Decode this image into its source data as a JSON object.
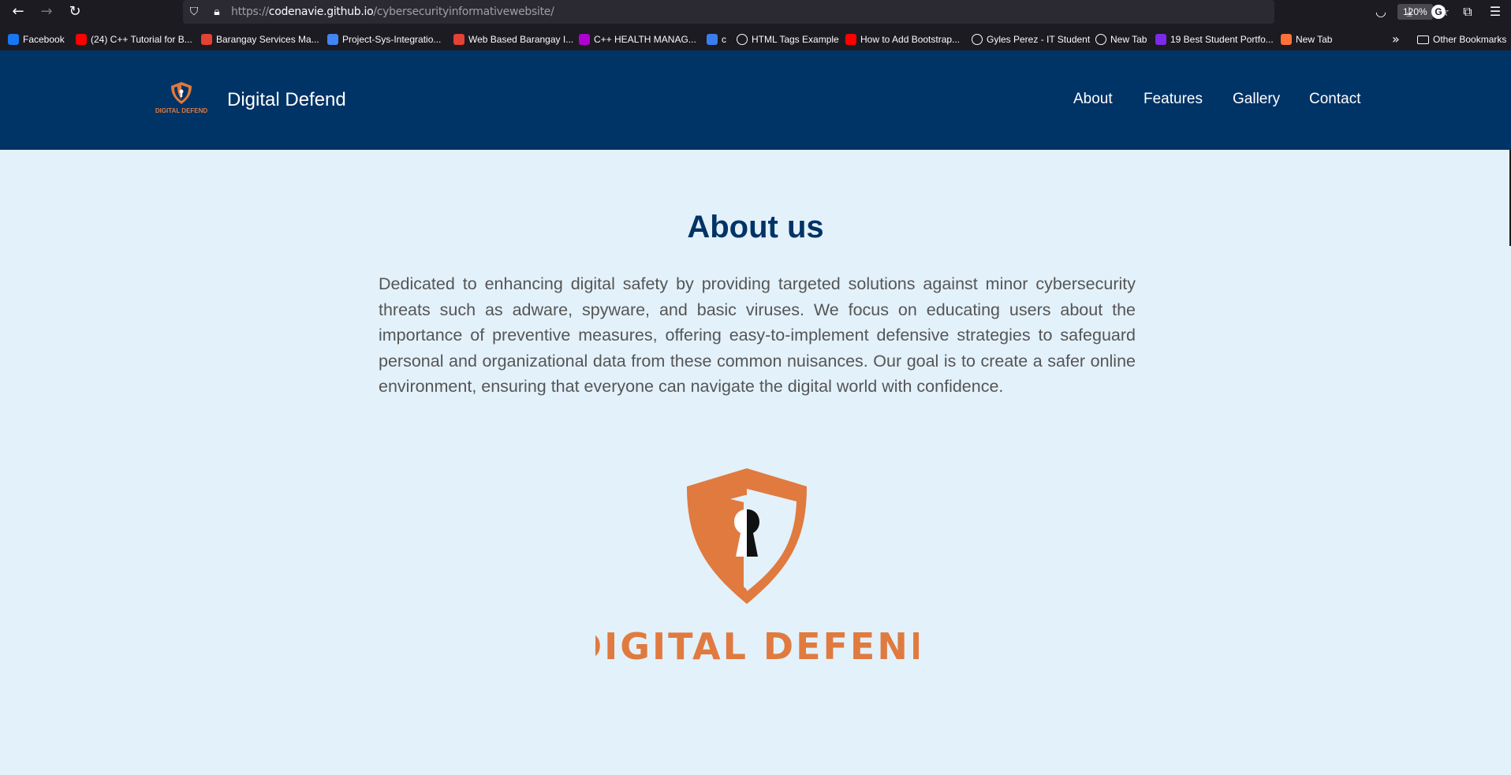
{
  "browser": {
    "url_prefix": "https://",
    "url_host": "codenavie.github.io",
    "url_path": "/cybersecurityinformativewebsite/",
    "zoom": "120%",
    "profile_initial": "G",
    "bookmarks": [
      {
        "label": "Facebook",
        "icon": "facebook-icon",
        "color": "#1877f2"
      },
      {
        "label": "(24) C++ Tutorial for B...",
        "icon": "youtube-icon",
        "color": "#ff0000"
      },
      {
        "label": "Barangay Services Ma...",
        "icon": "c-logo-icon",
        "color": "#e34234"
      },
      {
        "label": "Project-Sys-Integratio...",
        "icon": "docs-icon",
        "color": "#4285f4"
      },
      {
        "label": "Web Based Barangay I...",
        "icon": "c-logo-icon",
        "color": "#e34234"
      },
      {
        "label": "C++ HEALTH MANAG...",
        "icon": "cs-icon",
        "color": "#b000d0"
      },
      {
        "label": "c",
        "icon": "cpp-icon",
        "color": "#3b7ded"
      },
      {
        "label": "HTML Tags Example",
        "icon": "globe-icon",
        "color": "#fbfbfe"
      },
      {
        "label": "How to Add Bootstrap...",
        "icon": "youtube-icon",
        "color": "#ff0000"
      },
      {
        "label": "Gyles Perez - IT Student",
        "icon": "globe-icon",
        "color": "#fbfbfe"
      },
      {
        "label": "New Tab",
        "icon": "globe-icon",
        "color": "#fbfbfe"
      },
      {
        "label": "19 Best Student Portfo...",
        "icon": "canva-icon",
        "color": "#7d2ae8"
      },
      {
        "label": "New Tab",
        "icon": "firefox-icon",
        "color": "#ff7139"
      }
    ],
    "other_bookmarks": "Other Bookmarks"
  },
  "site": {
    "brand_name": "Digital Defend",
    "logo_text": "DIGITAL DEFEND",
    "nav": [
      "About",
      "Features",
      "Gallery",
      "Contact"
    ],
    "accent_color": "#003366",
    "logo_color": "#e07a3f"
  },
  "about": {
    "title": "About us",
    "body": "Dedicated to enhancing digital safety by providing targeted solutions against minor cybersecurity threats such as adware, spyware, and basic viruses. We focus on educating users about the importance of preventive measures, offering easy-to-implement defensive strategies to safeguard personal and organizational data from these common nuisances. Our goal is to create a safer online environment, ensuring that everyone can navigate the digital world with confidence."
  }
}
